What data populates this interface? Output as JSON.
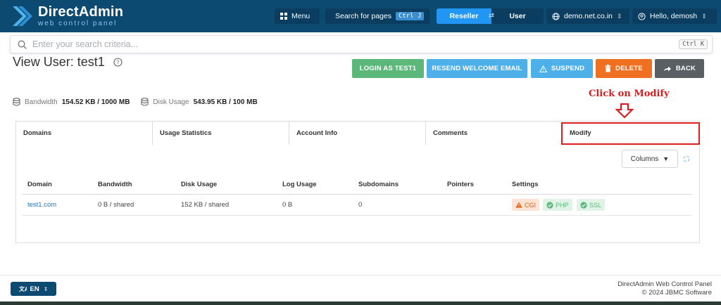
{
  "brand": {
    "title": "DirectAdmin",
    "subtitle": "web control panel"
  },
  "topbar": {
    "menu_label": "Menu",
    "search_pages_label": "Search for pages",
    "search_pages_kbd": "Ctrl J",
    "role_active": "Reseller",
    "role_inactive": "User",
    "domain_label": "demo.net.co.in",
    "user_label": "Hello, demosh"
  },
  "search": {
    "placeholder": "Enter your search criteria...",
    "kbd": "Ctrl K"
  },
  "page": {
    "title": "View User: test1"
  },
  "actions": {
    "login": "LOGIN AS TEST1",
    "resend": "RESEND WELCOME EMAIL",
    "suspend": "SUSPEND",
    "delete": "DELETE",
    "back": "BACK"
  },
  "annotation": {
    "text": "Click on Modify"
  },
  "usage": {
    "bandwidth_label": "Bandwidth",
    "bandwidth_value": "154.52 KB / 1000 MB",
    "disk_label": "Disk Usage",
    "disk_value": "543.95 KB / 100 MB"
  },
  "tabs": [
    "Domains",
    "Usage Statistics",
    "Account Info",
    "Comments",
    "Modify"
  ],
  "table": {
    "columns_button": "Columns",
    "headers": [
      "Domain",
      "Bandwidth",
      "Disk Usage",
      "Log Usage",
      "Subdomains",
      "Pointers",
      "Settings"
    ],
    "rows": [
      {
        "domain": "test1.com",
        "bandwidth": "0 B / shared",
        "disk": "152 KB / shared",
        "log": "0 B",
        "subdomains": "0",
        "pointers": "",
        "badges": [
          "CGI",
          "PHP",
          "SSL"
        ]
      }
    ]
  },
  "footer": {
    "lang": "EN",
    "line1": "DirectAdmin Web Control Panel",
    "line2": "© 2024 JBMC Software"
  },
  "colors": {
    "topbar": "#0d4a72",
    "login_btn": "#5cb87a",
    "resend_btn": "#4db0e8",
    "suspend_btn": "#4db0e8",
    "delete_btn": "#f07021",
    "back_btn": "#5a5f63",
    "annotation": "#e01e1e"
  }
}
